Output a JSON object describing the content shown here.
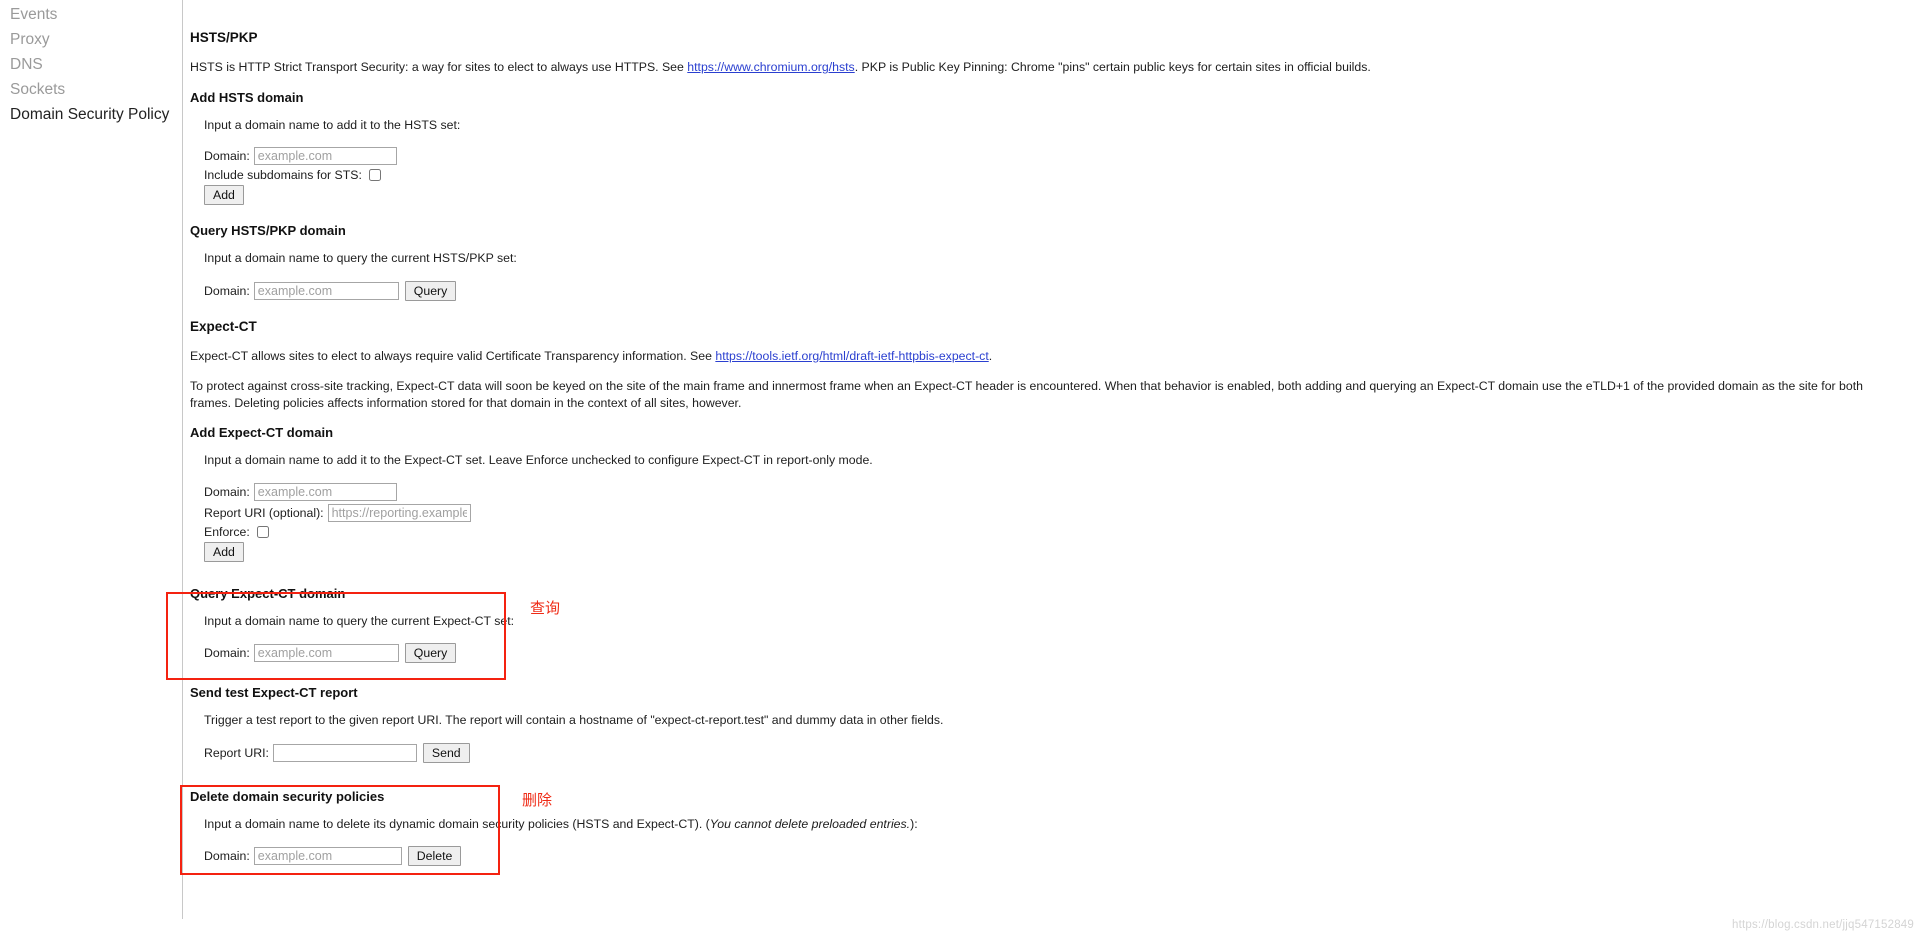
{
  "sidebar": {
    "items": [
      {
        "label": "Events",
        "active": false
      },
      {
        "label": "Proxy",
        "active": false
      },
      {
        "label": "DNS",
        "active": false
      },
      {
        "label": "Sockets",
        "active": false
      },
      {
        "label": "Domain Security Policy",
        "active": true
      }
    ]
  },
  "hsts_pkp": {
    "heading": "HSTS/PKP",
    "description_part1": "HSTS is HTTP Strict Transport Security: a way for sites to elect to always use HTTPS. See ",
    "link_text": "https://www.chromium.org/hsts",
    "description_part2": ". PKP is Public Key Pinning: Chrome \"pins\" certain public keys for certain sites in official builds."
  },
  "add_hsts": {
    "heading": "Add HSTS domain",
    "instruction": "Input a domain name to add it to the HSTS set:",
    "domain_label": "Domain:",
    "domain_placeholder": "example.com",
    "domain_value": "",
    "subdomains_label": "Include subdomains for STS:",
    "subdomains_checked": false,
    "add_button": "Add"
  },
  "query_hsts": {
    "heading": "Query HSTS/PKP domain",
    "instruction": "Input a domain name to query the current HSTS/PKP set:",
    "domain_label": "Domain:",
    "domain_placeholder": "example.com",
    "domain_value": "",
    "query_button": "Query"
  },
  "expect_ct": {
    "heading": "Expect-CT",
    "description_part1": "Expect-CT allows sites to elect to always require valid Certificate Transparency information. See ",
    "link_text": "https://tools.ietf.org/html/draft-ietf-httpbis-expect-ct",
    "description_part2": ".",
    "note": "To protect against cross-site tracking, Expect-CT data will soon be keyed on the site of the main frame and innermost frame when an Expect-CT header is encountered. When that behavior is enabled, both adding and querying an Expect-CT domain use the eTLD+1 of the provided domain as the site for both frames. Deleting policies affects information stored for that domain in the context of all sites, however."
  },
  "add_expect_ct": {
    "heading": "Add Expect-CT domain",
    "instruction": "Input a domain name to add it to the Expect-CT set. Leave Enforce unchecked to configure Expect-CT in report-only mode.",
    "domain_label": "Domain:",
    "domain_placeholder": "example.com",
    "domain_value": "",
    "report_uri_label": "Report URI (optional):",
    "report_uri_placeholder": "https://reporting.example.cor",
    "report_uri_value": "",
    "enforce_label": "Enforce:",
    "enforce_checked": false,
    "add_button": "Add"
  },
  "query_expect_ct": {
    "heading": "Query Expect-CT domain",
    "instruction": "Input a domain name to query the current Expect-CT set:",
    "domain_label": "Domain:",
    "domain_placeholder": "example.com",
    "domain_value": "",
    "query_button": "Query"
  },
  "send_test_report": {
    "heading": "Send test Expect-CT report",
    "instruction": "Trigger a test report to the given report URI. The report will contain a hostname of \"expect-ct-report.test\" and dummy data in other fields.",
    "report_uri_label": "Report URI:",
    "report_uri_value": "",
    "send_button": "Send"
  },
  "delete_policies": {
    "heading": "Delete domain security policies",
    "instruction_plain": "Input a domain name to delete its dynamic domain security policies (HSTS and Expect-CT). (",
    "instruction_italic": "You cannot delete preloaded entries.",
    "instruction_tail": "):",
    "domain_label": "Domain:",
    "domain_placeholder": "example.com",
    "domain_value": "",
    "delete_button": "Delete"
  },
  "annotations": {
    "query_label": "查询",
    "delete_label": "删除",
    "box_color": "#f42210"
  },
  "watermark": "https://blog.csdn.net/jjq547152849"
}
